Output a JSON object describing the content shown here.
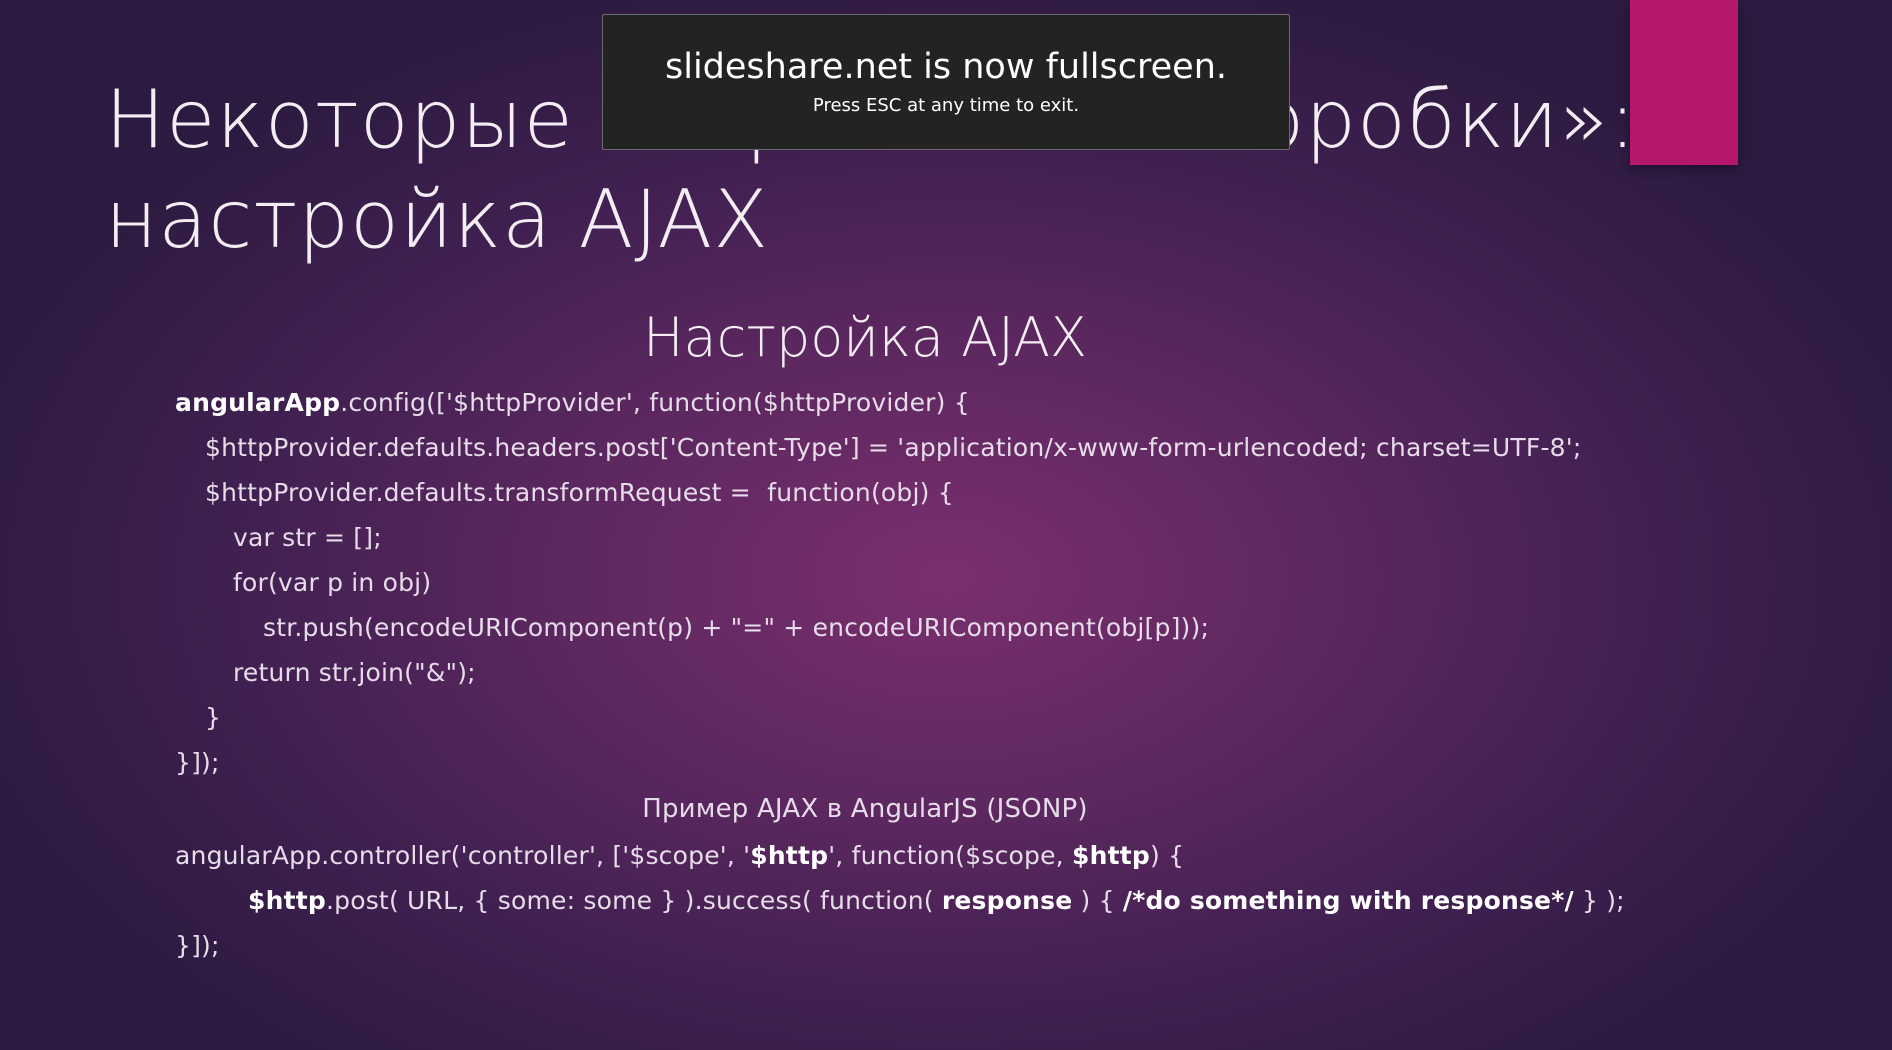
{
  "colors": {
    "background": "#4a2457",
    "accent_bar": "#b5176b",
    "notice_background": "#232323",
    "text": "#ffffff"
  },
  "fullscreen_notice": {
    "title": "slideshare.net is now fullscreen.",
    "subtitle": "Press ESC at any time to exit."
  },
  "slide": {
    "title_line1": "Некоторые «сервисы «из коробки»:",
    "title_line2": "настройка AJAX",
    "heading": "Настройка AJAX",
    "code1": {
      "line1_bold": "angularApp",
      "line1_rest": ".config(['$httpProvider', function($httpProvider) {",
      "line2": "$httpProvider.defaults.headers.post['Content-Type'] = 'application/x-www-form-urlencoded; charset=UTF-8';",
      "line3": "$httpProvider.defaults.transformRequest =  function(obj) {",
      "line4": "var str = [];",
      "line5": "for(var p in obj)",
      "line6": "str.push(encodeURIComponent(p) + \"=\" + encodeURIComponent(obj[p]));",
      "line7": "return str.join(\"&\");",
      "line8": "}",
      "line9": "}]);"
    },
    "subheading": "Пример AJAX в AngularJS (JSONP)",
    "code2": {
      "l1_a": "angularApp.controller('controller', ['$scope', '",
      "l1_b": "$http",
      "l1_c": "', function($scope, ",
      "l1_d": "$http",
      "l1_e": ") {",
      "l2_a": "$http",
      "l2_b": ".post( URL, { some: some } ).success( function( ",
      "l2_c": "response",
      "l2_d": " ) { ",
      "l2_e": "/*do something with response*/",
      "l2_f": " } );",
      "l3": "}]);"
    }
  }
}
